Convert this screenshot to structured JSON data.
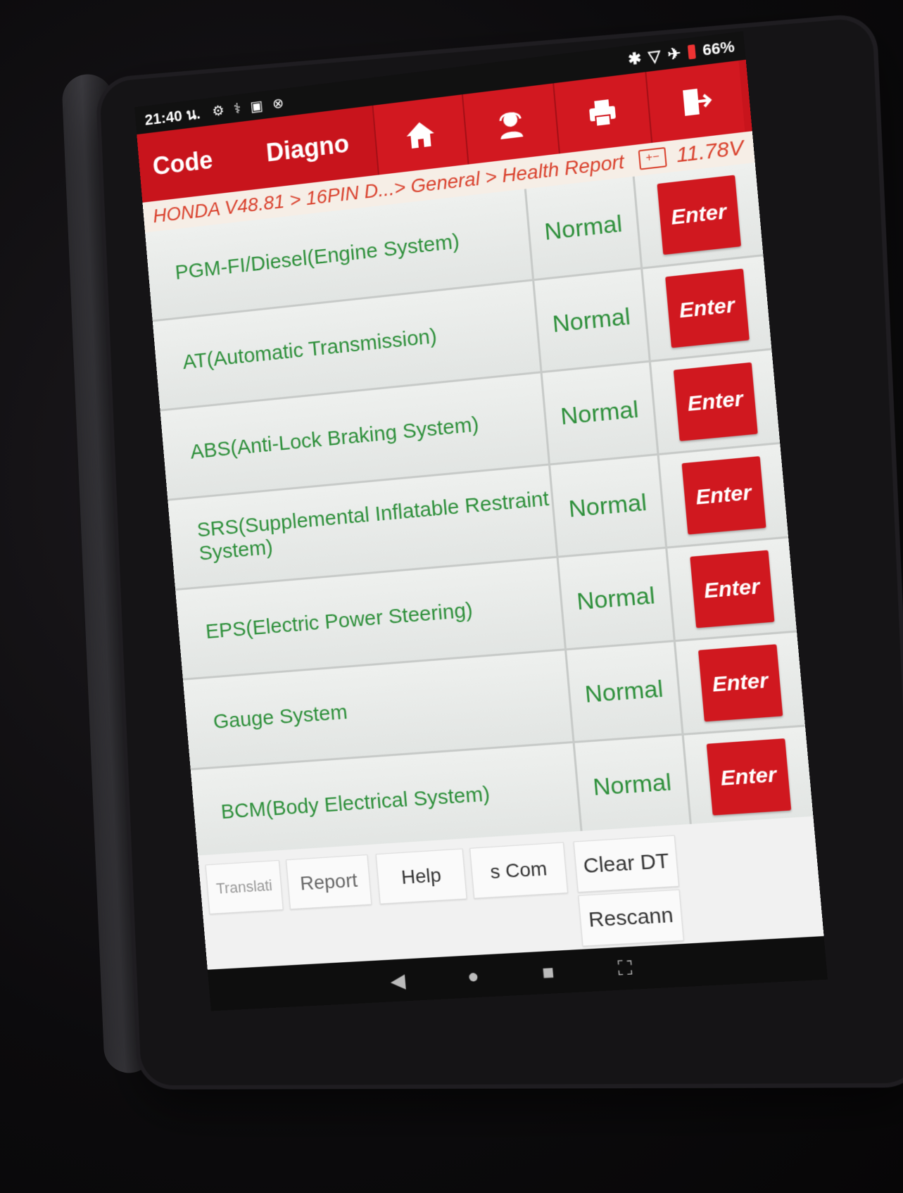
{
  "status_bar": {
    "time": "21:40 น.",
    "icons_left": [
      "gear-icon",
      "stethoscope-icon",
      "image-icon",
      "no-signal-icon"
    ],
    "icons_right": [
      "bluetooth-icon",
      "wifi-icon",
      "airplane-icon",
      "battery-icon"
    ],
    "battery": "66%"
  },
  "header": {
    "tab_code": "Code",
    "tab_diag": "Diagno",
    "buttons": [
      "home-icon",
      "support-icon",
      "print-icon",
      "exit-icon"
    ],
    "color": "#c8141c"
  },
  "breadcrumb": {
    "path": "HONDA V48.81 > 16PIN D...> General > Health Report",
    "voltage": "11.78V"
  },
  "systems": [
    {
      "name": "PGM-FI/Diesel(Engine System)",
      "status": "Normal",
      "action": "Enter"
    },
    {
      "name": "AT(Automatic Transmission)",
      "status": "Normal",
      "action": "Enter"
    },
    {
      "name": "ABS(Anti-Lock Braking System)",
      "status": "Normal",
      "action": "Enter"
    },
    {
      "name": "SRS(Supplemental Inflatable Restraint System)",
      "status": "Normal",
      "action": "Enter"
    },
    {
      "name": "EPS(Electric Power Steering)",
      "status": "Normal",
      "action": "Enter"
    },
    {
      "name": "Gauge System",
      "status": "Normal",
      "action": "Enter"
    },
    {
      "name": "BCM(Body Electrical System)",
      "status": "Normal",
      "action": "Enter"
    }
  ],
  "toolbar": {
    "translate": "Translati",
    "report": "Report",
    "help": "Help",
    "compare": "s Com",
    "clear_dtc": "Clear DT",
    "rescan": "Rescann"
  },
  "navbar": {
    "buttons": [
      "back-icon",
      "home-circle-icon",
      "recents-icon",
      "screenshot-icon"
    ]
  }
}
